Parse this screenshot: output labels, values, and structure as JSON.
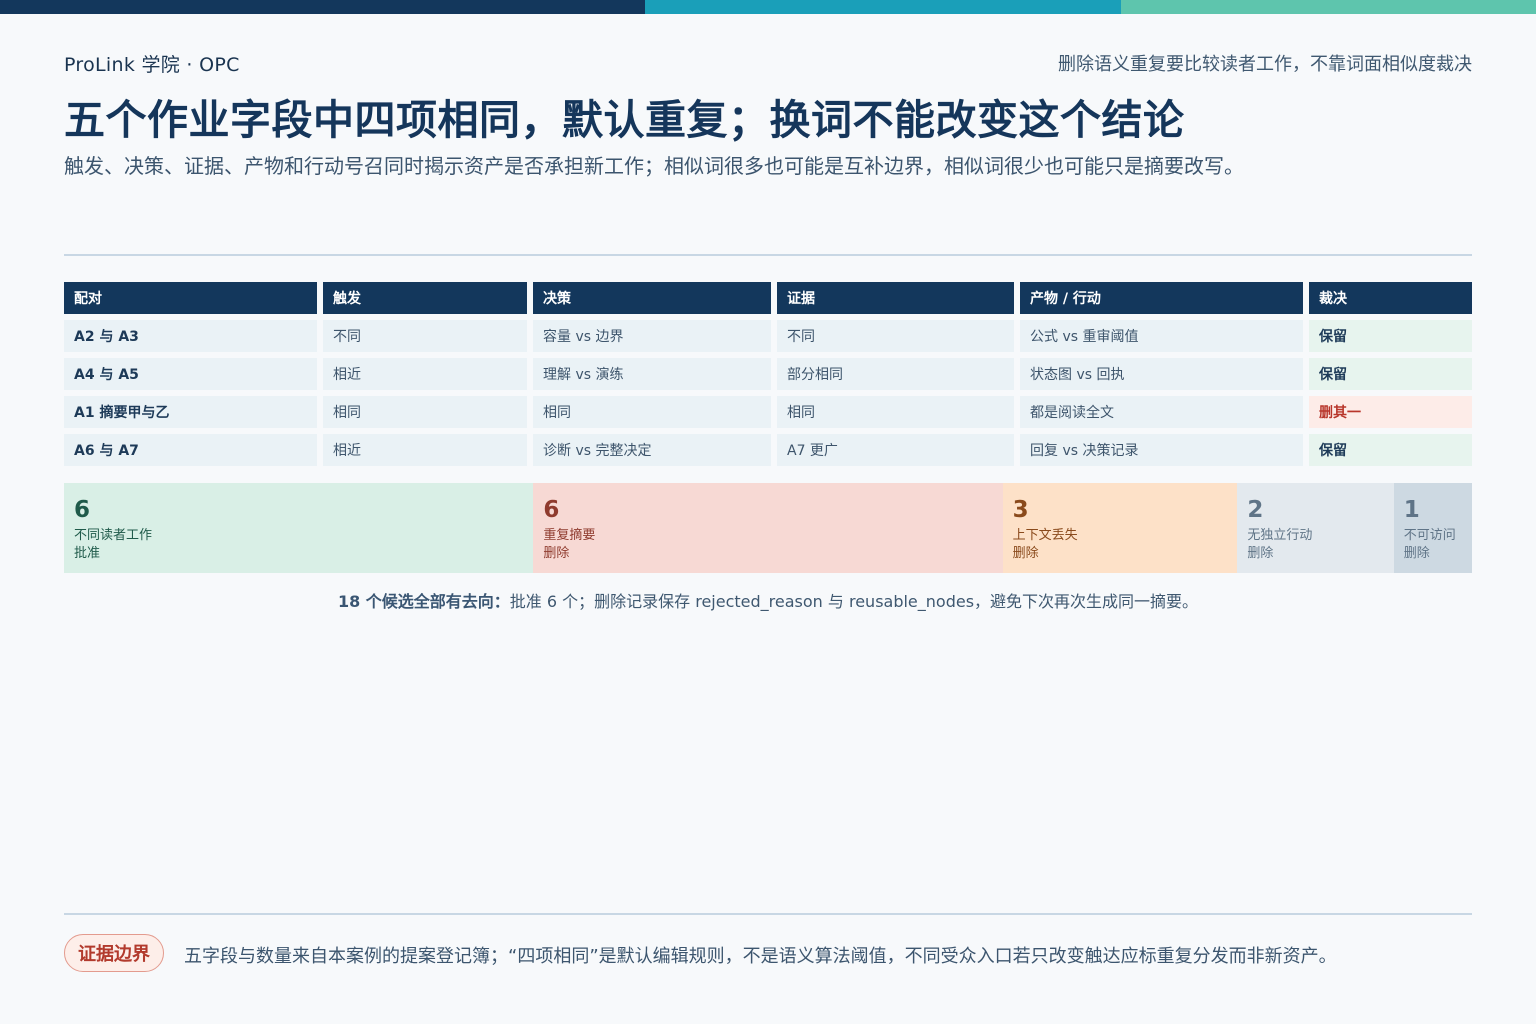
{
  "header": {
    "brand": "ProLink 学院 · OPC",
    "tagline": "删除语义重复要比较读者工作，不靠词面相似度裁决",
    "title": "五个作业字段中四项相同，默认重复；换词不能改变这个结论",
    "subtitle": "触发、决策、证据、产物和行动号召同时揭示资产是否承担新工作；相似词很多也可能是互补边界，相似词很少也可能只是摘要改写。"
  },
  "table": {
    "headers": [
      "配对",
      "触发",
      "决策",
      "证据",
      "产物 / 行动",
      "裁决"
    ],
    "rows": [
      {
        "pair": "A2 与 A3",
        "trigger": "不同",
        "decision": "容量 vs 边界",
        "evidence": "不同",
        "output": "公式 vs 重审阈值",
        "verdict": "保留",
        "status": "keep"
      },
      {
        "pair": "A4 与 A5",
        "trigger": "相近",
        "decision": "理解 vs 演练",
        "evidence": "部分相同",
        "output": "状态图 vs 回执",
        "verdict": "保留",
        "status": "keep"
      },
      {
        "pair": "A1 摘要甲与乙",
        "trigger": "相同",
        "decision": "相同",
        "evidence": "相同",
        "output": "都是阅读全文",
        "verdict": "删其一",
        "status": "drop"
      },
      {
        "pair": "A6 与 A7",
        "trigger": "相近",
        "decision": "诊断 vs 完整决定",
        "evidence": "A7 更广",
        "output": "回复 vs 决策记录",
        "verdict": "保留",
        "status": "keep"
      }
    ]
  },
  "breakdown": {
    "segments": [
      {
        "count": 6,
        "label": "不同读者工作",
        "action": "批准",
        "bg": "#d9efe6",
        "fg": "#1f5a4a"
      },
      {
        "count": 6,
        "label": "重复摘要",
        "action": "删除",
        "bg": "#f7d9d4",
        "fg": "#8f3b2e"
      },
      {
        "count": 3,
        "label": "上下文丢失",
        "action": "删除",
        "bg": "#fde1c8",
        "fg": "#8a4a1c"
      },
      {
        "count": 2,
        "label": "无独立行动",
        "action": "删除",
        "bg": "#e3e9ee",
        "fg": "#5f7487"
      },
      {
        "count": 1,
        "label": "不可访问",
        "action": "删除",
        "bg": "#cdd9e2",
        "fg": "#5f7487"
      }
    ],
    "summary_lead": "18 个候选全部有去向：",
    "summary_rest": "批准 6 个；删除记录保存 rejected_reason 与 reusable_nodes，避免下次再次生成同一摘要。"
  },
  "footer": {
    "pill": "证据边界",
    "note": "五字段与数量来自本案例的提案登记簿；“四项相同”是默认编辑规则，不是语义算法阈值，不同受众入口若只改变触达应标重复分发而非新资产。"
  }
}
